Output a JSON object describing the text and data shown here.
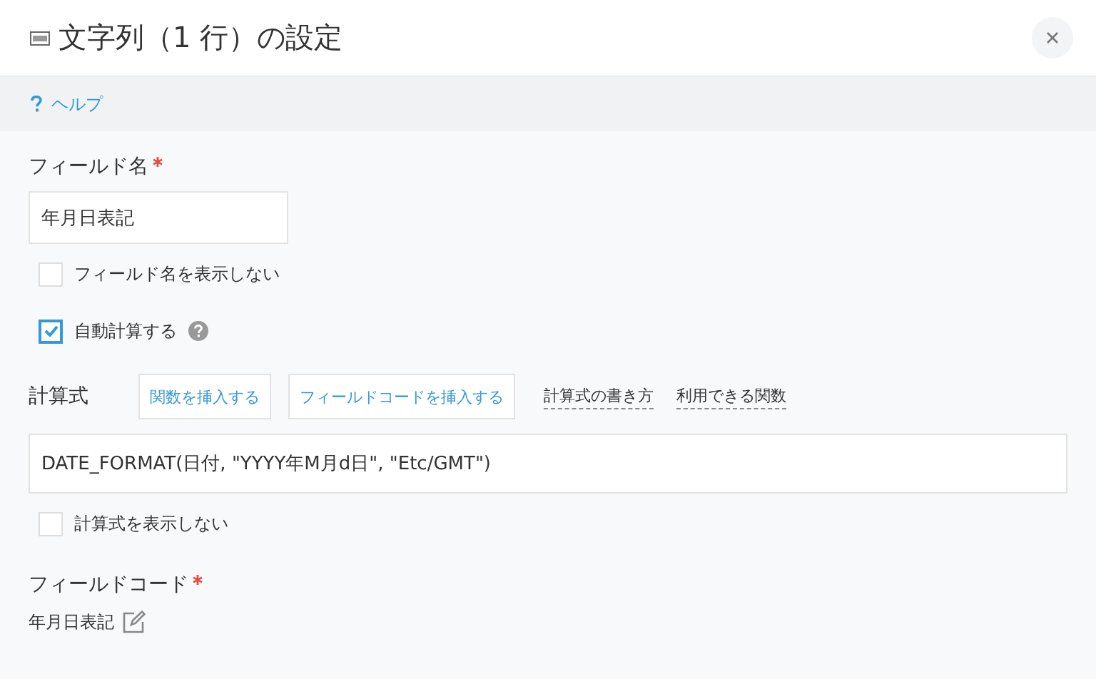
{
  "window": {
    "title": "文字列（1 行）の設定"
  },
  "help": {
    "label": "ヘルプ"
  },
  "field_name": {
    "label": "フィールド名",
    "required": true,
    "value": "年月日表記"
  },
  "options": [
    {
      "label": "フィールド名を表示しない",
      "checked": false,
      "help_icon": false
    },
    {
      "label": "自動計算する",
      "checked": true,
      "help_icon": true
    }
  ],
  "formula": {
    "label": "計算式",
    "buttons": [
      "関数を挿入する",
      "フィールドコードを挿入する"
    ],
    "links": [
      "計算式の書き方",
      "利用できる関数"
    ],
    "value": "DATE_FORMAT(日付, \"YYYY年M月d日\", \"Etc/GMT\")"
  },
  "formula_options": [
    {
      "label": "計算式を表示しない",
      "checked": false
    }
  ],
  "field_code": {
    "label": "フィールドコード",
    "required": true,
    "value": "年月日表記"
  }
}
